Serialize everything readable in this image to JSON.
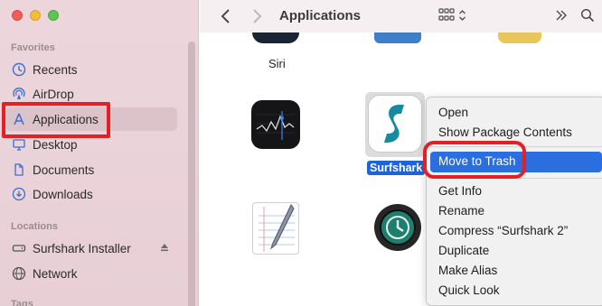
{
  "window": {
    "title": "Applications"
  },
  "sidebar": {
    "favorites_title": "Favorites",
    "items": [
      {
        "label": "Recents",
        "icon": "clock-icon"
      },
      {
        "label": "AirDrop",
        "icon": "airdrop-icon"
      },
      {
        "label": "Applications",
        "icon": "applications-icon",
        "selected": true
      },
      {
        "label": "Desktop",
        "icon": "desktop-icon"
      },
      {
        "label": "Documents",
        "icon": "document-icon"
      },
      {
        "label": "Downloads",
        "icon": "download-icon"
      }
    ],
    "locations_title": "Locations",
    "locations": [
      {
        "label": "Surfshark Installer",
        "icon": "drive-icon"
      },
      {
        "label": "Network",
        "icon": "globe-icon"
      }
    ],
    "tags_title": "Tags"
  },
  "apps": {
    "siri": "Siri",
    "surfshark": "Surfshark 2"
  },
  "context_menu": {
    "items": [
      "Open",
      "Show Package Contents",
      "Move to Trash",
      "Get Info",
      "Rename",
      "Compress “Surfshark 2”",
      "Duplicate",
      "Make Alias",
      "Quick Look"
    ],
    "highlighted": "Move to Trash"
  },
  "colors": {
    "accent": "#2a6ee0",
    "annotation": "#e41f26",
    "sidebar": "#ecd6dc"
  }
}
